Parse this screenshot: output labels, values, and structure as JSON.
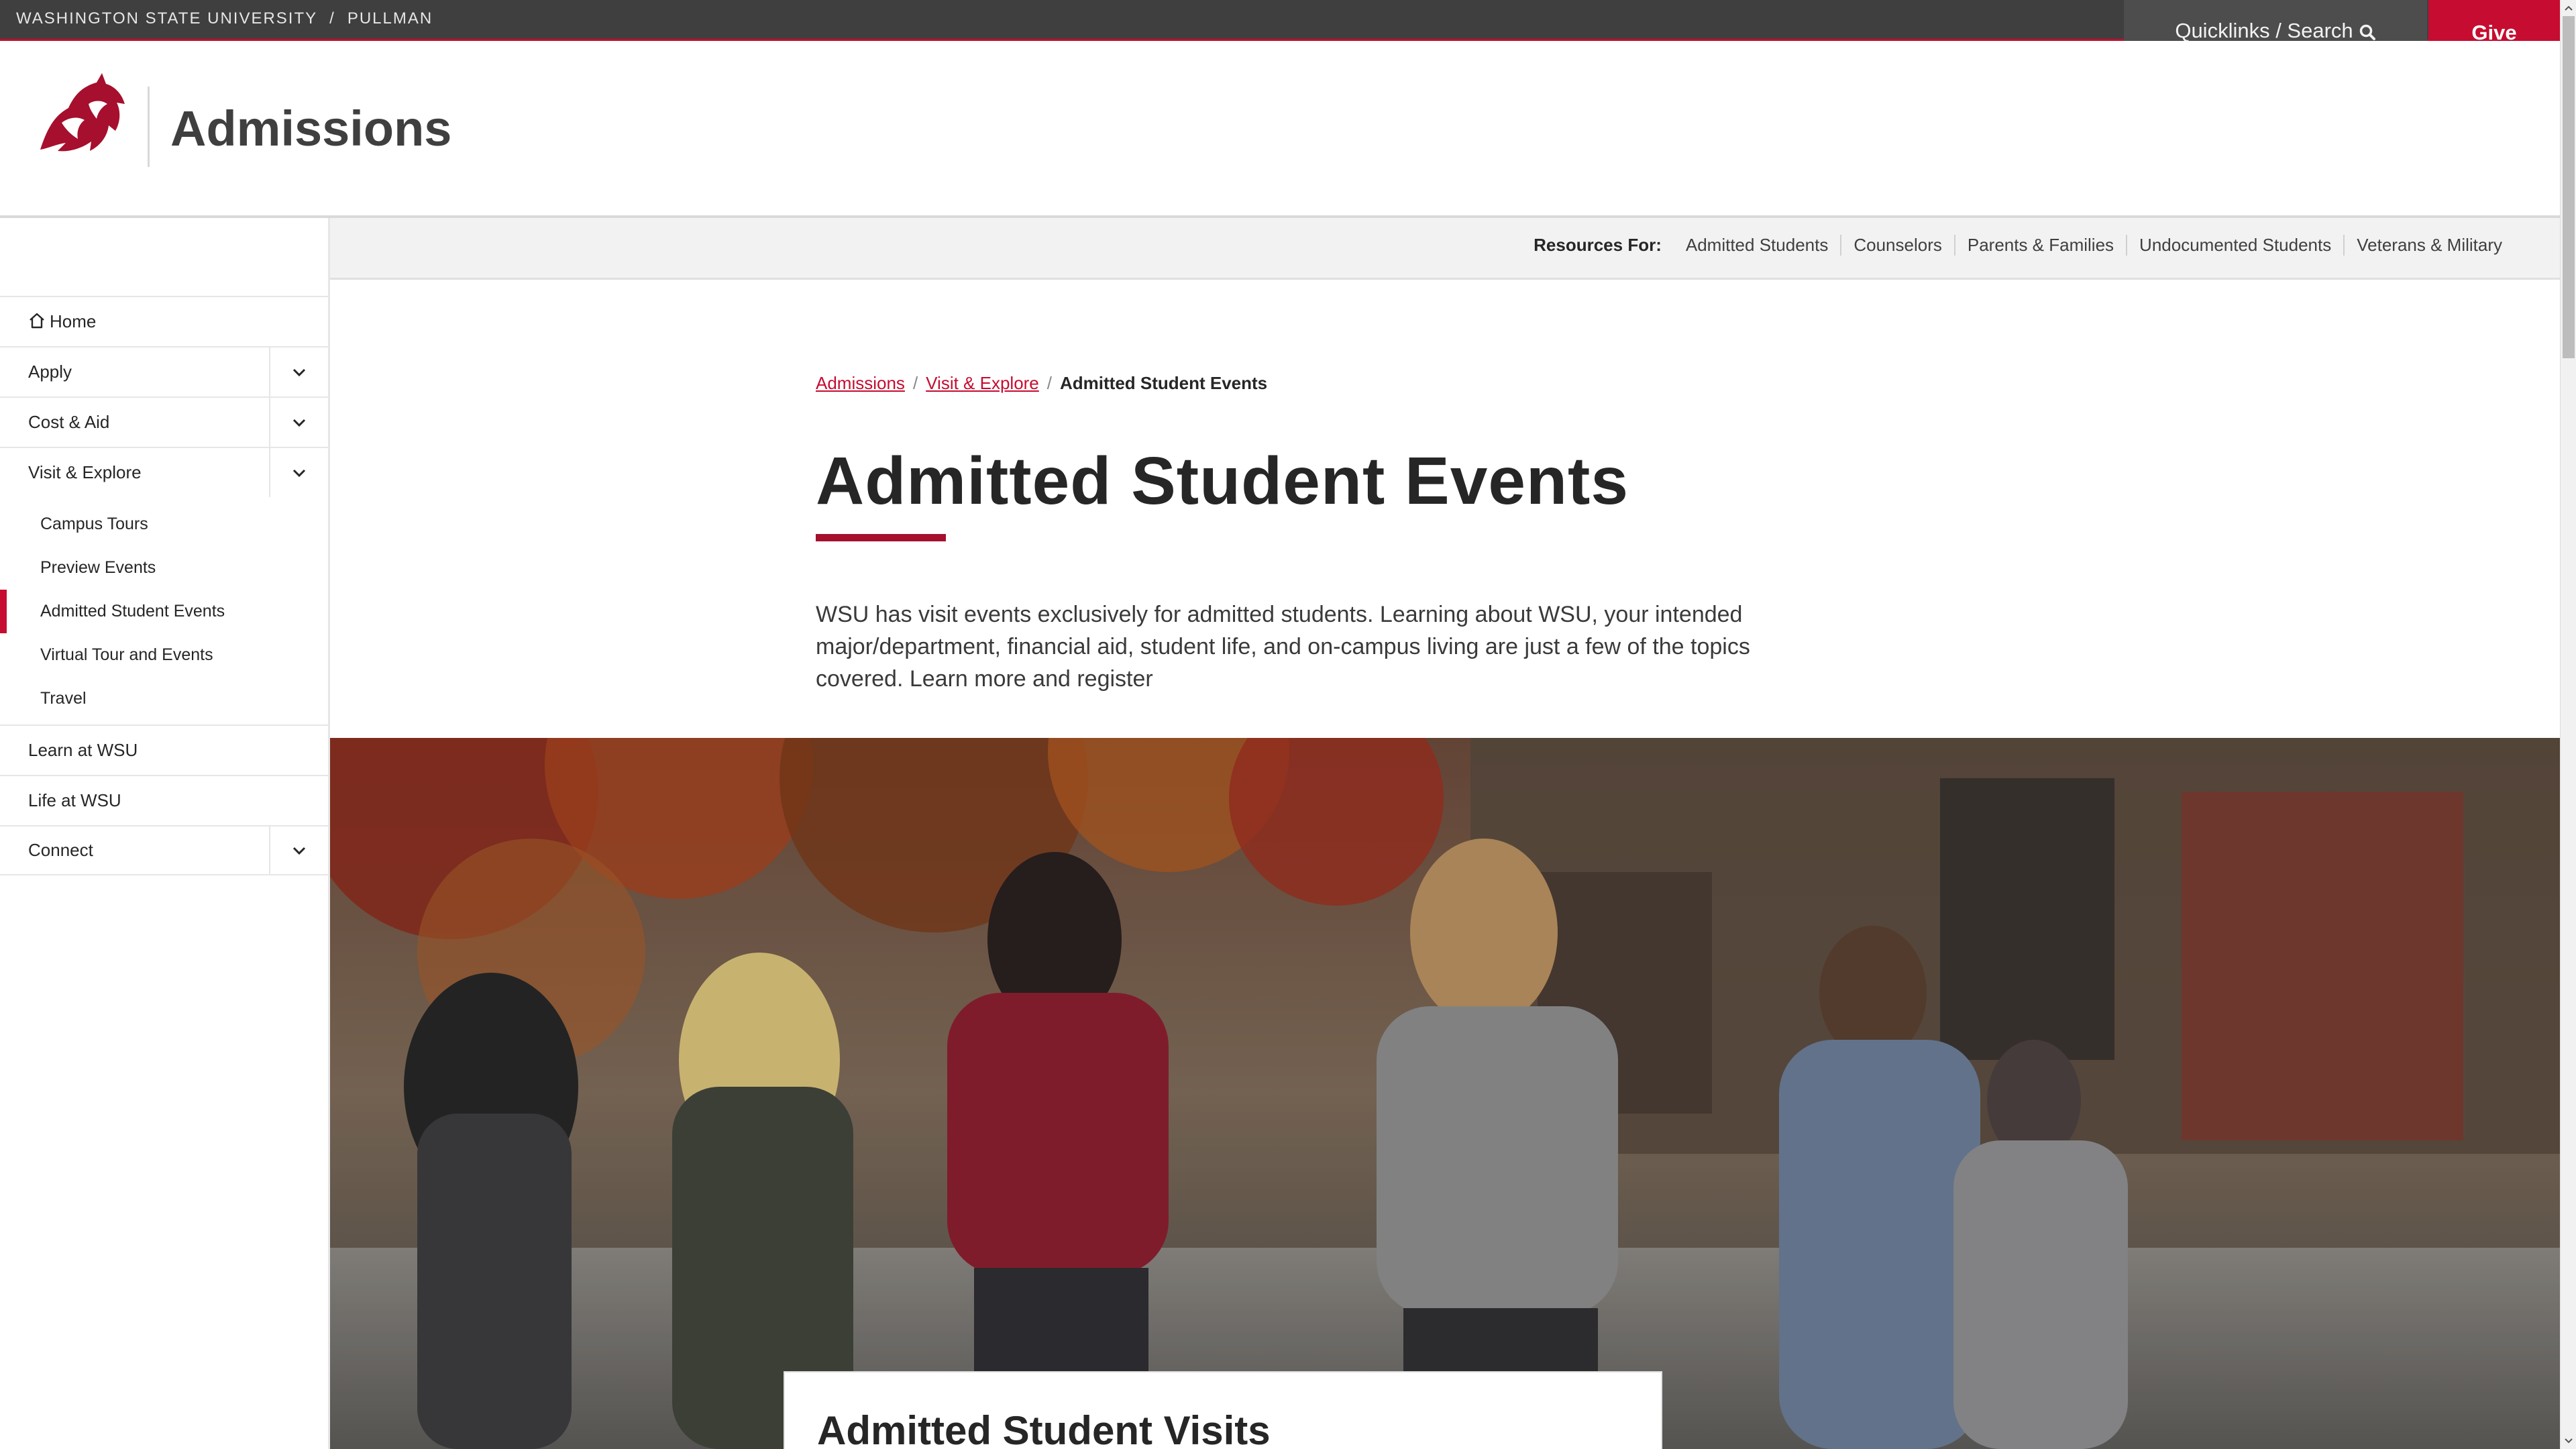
{
  "topbar": {
    "university": "WASHINGTON STATE UNIVERSITY",
    "separator": "/",
    "campus": "PULLMAN",
    "quicklinks_label": "Quicklinks / Search",
    "give_label": "Give"
  },
  "header": {
    "site_title": "Admissions"
  },
  "resources": {
    "label": "Resources For:",
    "links": [
      "Admitted Students",
      "Counselors",
      "Parents & Families",
      "Undocumented Students",
      "Veterans & Military"
    ]
  },
  "sidebar": {
    "items": [
      {
        "label": "Home"
      },
      {
        "label": "Apply"
      },
      {
        "label": "Cost & Aid"
      },
      {
        "label": "Visit & Explore"
      },
      {
        "label": "Learn at WSU"
      },
      {
        "label": "Life at WSU"
      },
      {
        "label": "Connect"
      }
    ],
    "sub_items": [
      {
        "label": "Campus Tours"
      },
      {
        "label": "Preview Events"
      },
      {
        "label": "Admitted Student Events"
      },
      {
        "label": "Virtual Tour and Events"
      },
      {
        "label": "Travel"
      }
    ]
  },
  "breadcrumb": {
    "items": [
      "Admissions",
      "Visit & Explore"
    ],
    "separator": "/",
    "current": "Admitted Student Events"
  },
  "main": {
    "title": "Admitted Student Events",
    "intro": "WSU has visit events exclusively for admitted students. Learning about WSU, your intended major/department, financial aid, student life, and on-campus living are just a few of the topics covered. Learn more and register",
    "card_title": "Admitted Student Visits"
  },
  "colors": {
    "crimson": "#c60c30",
    "dark_crimson": "#a60f2d",
    "gray_bar": "#3f3f3f"
  },
  "icons": {
    "logo": "wsu-cougar-logo",
    "search": "search-icon",
    "home": "home-icon",
    "toggle": "chevron-down-icon"
  }
}
